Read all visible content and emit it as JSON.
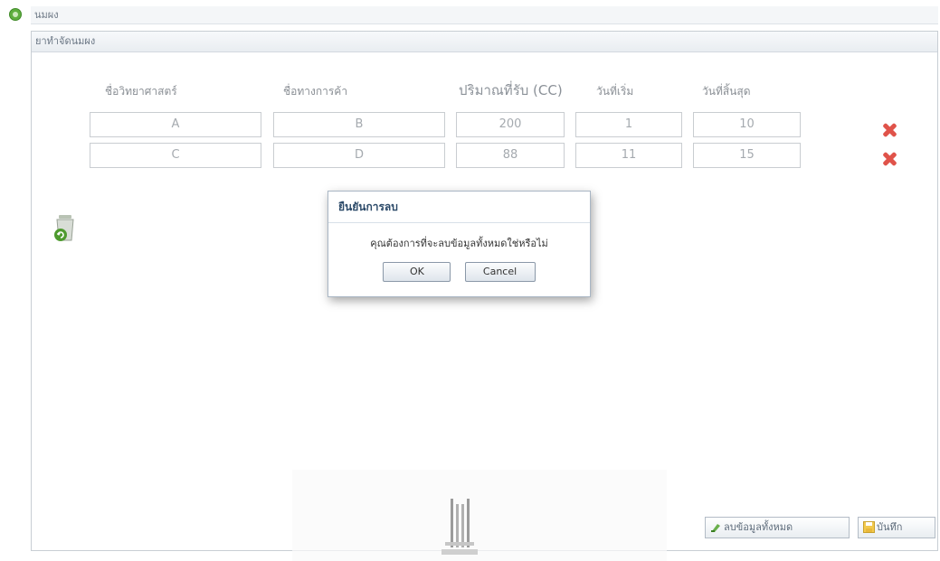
{
  "window": {
    "title": "นมผง"
  },
  "panel": {
    "header": "ยาทำจัดนมผง"
  },
  "columns": {
    "c1": "ชื่อวิทยาศาสตร์",
    "c2": "ชื่อทางการค้า",
    "c3": "ปริมาณที่รับ (CC)",
    "c4": "วันที่เริ่ม",
    "c5": "วันที่สิ้นสุด"
  },
  "rows": [
    {
      "c1": "A",
      "c2": "B",
      "c3": "200",
      "c4": "1",
      "c5": "10"
    },
    {
      "c1": "C",
      "c2": "D",
      "c3": "88",
      "c4": "11",
      "c5": "15"
    }
  ],
  "dialog": {
    "title": "ยืนยันการลบ",
    "message": "คุณต้องการที่จะลบข้อมูลทั้งหมดใช่หรือไม่",
    "ok_label": "OK",
    "cancel_label": "Cancel"
  },
  "footer": {
    "delete_all_label": "ลบข้อมูลทั้งหมด",
    "save_label": "บันทึก"
  },
  "icons": {
    "app": "app-icon",
    "delete_row": "close-icon",
    "recycle": "recycle-icon",
    "delete_all": "delete-all-icon",
    "save": "save-icon"
  },
  "colors": {
    "delete_red": "#e0534a",
    "dialog_title": "#2c4a69"
  }
}
